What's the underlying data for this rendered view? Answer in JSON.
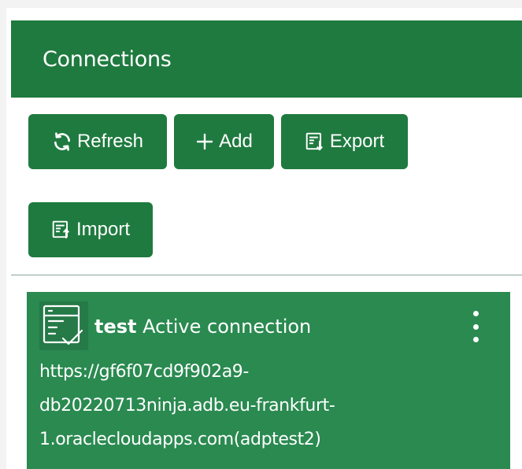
{
  "panel": {
    "title": "Connections"
  },
  "toolbar": {
    "refresh_label": "Refresh",
    "add_label": "Add",
    "export_label": "Export",
    "import_label": "Import"
  },
  "connection": {
    "name": "test",
    "status": "Active connection",
    "url_lines": [
      "https://gf6f07cd9f902a9-",
      "db20220713ninja.adb.eu-frankfurt-",
      "1.oraclecloudapps.com(adptest2)"
    ],
    "menu_icon": "kebab-menu-icon"
  },
  "colors": {
    "header_bg": "#1f7a3f",
    "button_bg": "#1f7a3f",
    "card_bg": "#2a8a50"
  },
  "icons": {
    "refresh": "refresh-icon",
    "add": "plus-icon",
    "export": "export-icon",
    "import": "import-icon",
    "connection": "connection-check-icon"
  }
}
